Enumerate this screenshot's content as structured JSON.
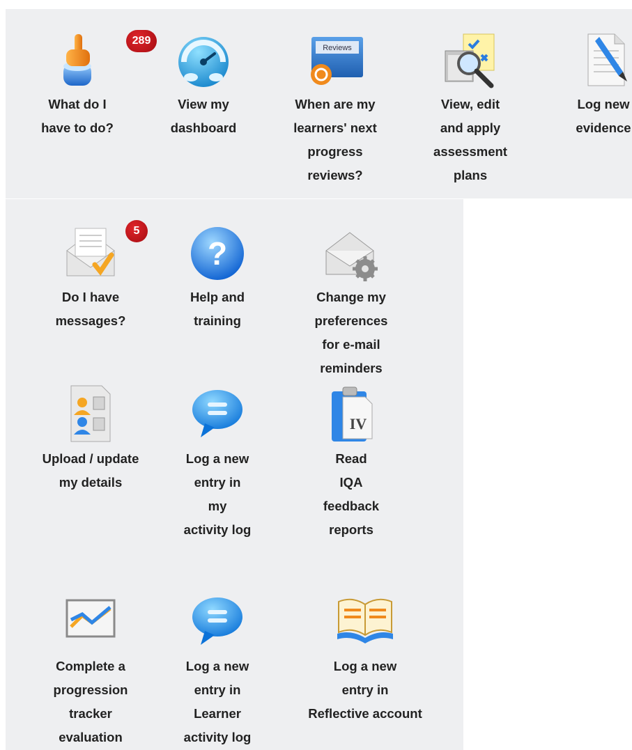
{
  "top_row": [
    {
      "label": "What do I\nhave to do?",
      "icon": "pointing-hand-icon",
      "badge": "289"
    },
    {
      "label": "View my\ndashboard",
      "icon": "dashboard-gauge-icon"
    },
    {
      "label": "When are my\nlearners' next\nprogress\nreviews?",
      "icon": "reviews-icon",
      "icon_text": "Reviews"
    },
    {
      "label": "View, edit\nand apply\nassessment\nplans",
      "icon": "assessment-plans-icon"
    },
    {
      "label": "Log new\nevidence",
      "icon": "log-evidence-icon"
    }
  ],
  "grid": [
    {
      "label": "Do I have\nmessages?",
      "icon": "messages-icon",
      "badge": "5"
    },
    {
      "label": "Help and\ntraining",
      "icon": "help-icon",
      "icon_text": "?"
    },
    {
      "label": "Change my\npreferences\nfor e-mail\nreminders",
      "icon": "email-preferences-icon"
    },
    {
      "label": "Upload / update\nmy details",
      "icon": "user-details-icon"
    },
    {
      "label": "Log a new\nentry in\nmy\nactivity log",
      "icon": "chat-bubble-icon"
    },
    {
      "label": "Read\nIQA\nfeedback\nreports",
      "icon": "iqa-report-icon",
      "icon_text": "IV"
    },
    {
      "label": "Complete a\nprogression\ntracker\nevaluation",
      "icon": "progression-chart-icon"
    },
    {
      "label": "Log a new\nentry in\nLearner\nactivity log",
      "icon": "chat-bubble-icon"
    },
    {
      "label": "Log a new\nentry in\nReflective account",
      "icon": "open-book-icon"
    }
  ]
}
